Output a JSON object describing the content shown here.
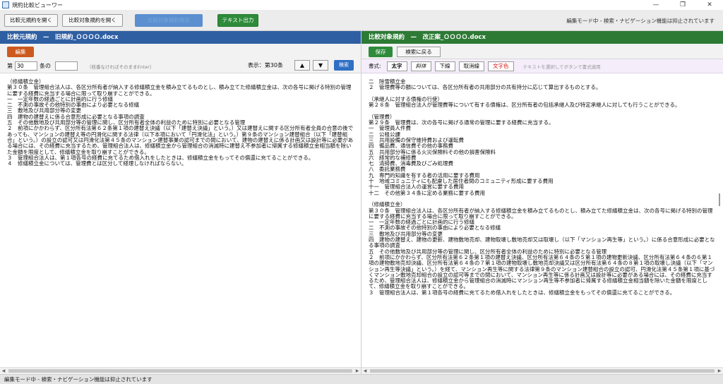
{
  "window": {
    "title": "規約比較ビューワー",
    "controls": [
      "—",
      "❐",
      "✕"
    ]
  },
  "toolbar": {
    "open_source": "比較元規約を開く",
    "open_target": "比較対象規約を開く",
    "disabled_button": "比較対象規約保存",
    "text_output": "テキスト出力",
    "edit_mode_notice": "編集モード中 - 検索・ナビゲーション機能は抑止されています"
  },
  "left_pane": {
    "header": "比較元規約　—　旧規約_ＯＯＯＯ.docx",
    "edit_label": "編集",
    "article_prefix": "第",
    "article_value": "30",
    "article_suffix": "条の",
    "sub_value": "",
    "hint": "（枝番なければそのままEnter）",
    "display_label": "表示：第30条",
    "up_label": "▲",
    "down_label": "▼",
    "search_label": "検索",
    "text": "（修繕積立金）\n第３０条　管理組合法人は、各区分所有者が納入する修繕積立金を積み立てるものとし、積み立てた修繕積立金は、次の各号に掲げる特別の管理に要する経費に充当する場合に限って取り崩すことができる。\n一　一定年数の経過ごとに計画的に行う修繕\n二　不測の事故その他特別の事由により必要となる修繕\n三　敷地及び共用部分等の変更\n四　建物の建替えに係る合意形成に必要となる事項の調査\n五　その他敷地及び共用部分等の管理に関し、区分所有者全体の利益のために特別に必要となる管理\n２　前項にかかわらず、区分所有法第６２条第１項の建替え決議（以下「建替え決議」という。）又は建替えに関する区分所有者全員の合意の後であっても、マンションの建替え等の円滑化に関する法律（以下本項において「円滑化法」という。）第９条のマンション建替組合（以下「建替組合」という。）の設立の認可又は円滑化法第４５条のマンション建替事業の認可までの間において、建物の建替えに係る計画又は設計等に必要がある場合には、その経費に充当するため、管理組合法人は、修繕積立金から管理組合の消滅時に建替え不参加者に帰属する修繕積立金相当額を除いた金額を限度として、修繕積立金を取り崩すことができる。\n３　管理組合法人は、第１項各号の経費に充てるため借入れをしたときは、修繕積立金をもってその償還に充てることができる。\n４　修繕積立金については、管理費とは区分して経理しなければならない。"
  },
  "right_pane": {
    "header": "比較対象規約　—　改正案_ＯＯＯＯ.docx",
    "save_label": "保存",
    "back_label": "検索に戻る",
    "format_label": "書式:",
    "bold_label": "太字",
    "italic_label": "斜体",
    "underline_label": "下線",
    "cancel_label": "取消線",
    "color_label": "文字色",
    "format_hint": "テキストを選択してボタンで書式適用",
    "text": "二　除雪積立金\n２　管理費等の額については、各区分所有者の共用部分の共有持分に応じて算出するものとする。\n\n（承継人に対する債権の行使）\n第２８条　管理組合法人が管理費等について有する債権は、区分所有者の包括承継人及び特定承継人に対しても行うことができる。\n\n（管理費）\n第２９条　管理費は、次の各号に掲げる通常の管理に要する経費に充当する。\n一　管理員人件費\n二　公租公課\n三　共用設備の保守維持費および運転費\n四　備品費、通信費その他の事務費\n五　共用部分等に係る火災保険料その他の損害保険料\n六　経常的な補修費\n七　清掃費、消毒費及びごみ処理費\n八　委託業務費\n九　専門的知識を有する者の活用に要する費用\n十　地域コミュニティにも配慮した居住者間のコミュニティ形成に要する費用\n十一　管理組合法人の運営に要する費用\n十二　その他第３４条に定める業務に要する費用\n\n（修繕積立金）\n第３０条　管理組合法人は、各区分所有者が納入する修繕積立金を積み立てるものとし、積み立てた修繕積立金は、次の各号に掲げる特別の管理に要する経費に充当する場合に限って取り崩すことができる。\n一　一定年数の経過ごとに計画的に行う修繕\n二　不測の事故その他特別の事由により必要となる修繕\n三　敷地及び共用部分等の変更\n四　建物の建替え、建物の更新、建物敷地売却、建物取壊し敷地売却又は取壊し（以下「マンション再生等」という。）に係る合意形成に必要となる事項の調査\n五　その他敷地及び共用部分等の管理に関し、区分所有者全体の利益のために特別に必要となる管理\n２　前項にかかわらず、区分所有法第６２条第１項の建替え決議、区分所有法第６４条の５第１項の建物更新決議、区分所有法第６４条の６第１項の建物敷地売却決議、区分所有法第６４条の７第１項の建物取壊し敷地売却決議又は区分所有法第６４条の８第１項の取壊し決議（以下「マンション再生等決議」という。）を経て、マンション再生等に関する法律第９条のマンション建替組合の設立の認可、円滑化法第４５条第１項に基づくマンション敷地売却組合の設立の認可等までの間において、マンション再生等に係る計画又は設計等に必要がある場合には、その経費に充当するため、管理組合法人は、修繕積立金から管理組合の消滅時にマンション再生等不参加者に帰属する修繕積立金相当額を除いた金額を限度として、修繕積立金を取り崩すことができる。\n３　管理組合法人は、第１項各号の経費に充てるため借入れをしたときは、修繕積立金をもってその償還に充てることができる。"
  },
  "statusbar": {
    "text": "編集モード中 - 検索・ナビゲーション機能は抑止されています"
  }
}
